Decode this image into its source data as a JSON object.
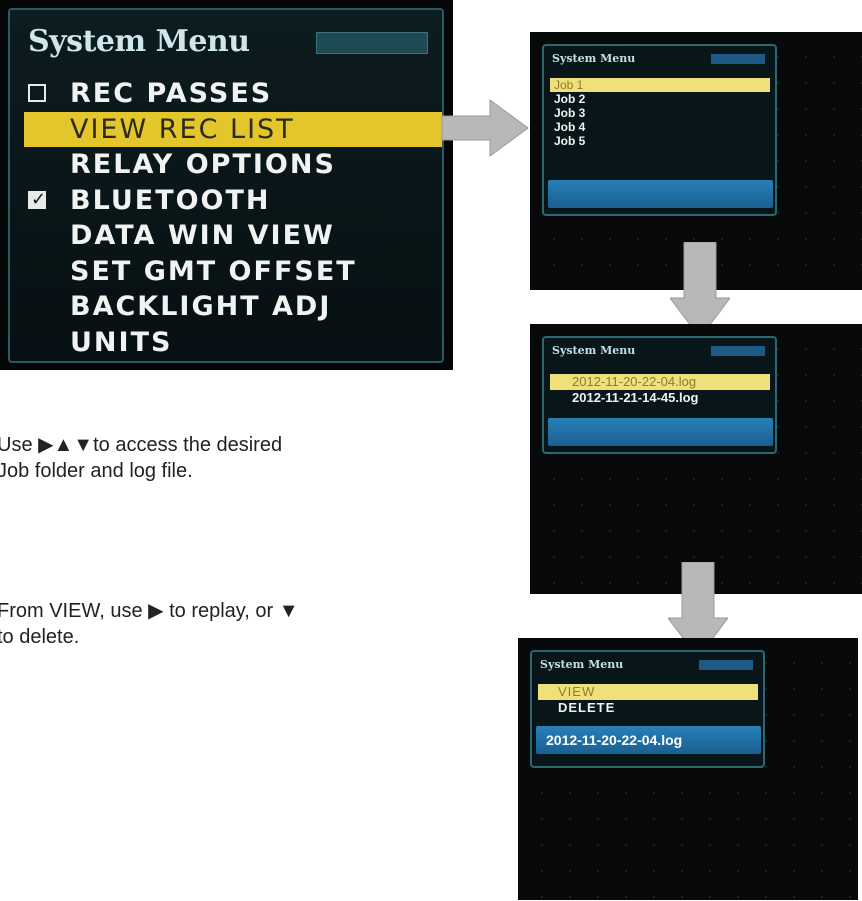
{
  "system_menu": {
    "title": "System Menu",
    "items": [
      {
        "label": "REC PASSES",
        "checkbox": "unchecked",
        "selected": false
      },
      {
        "label": "VIEW REC LIST",
        "checkbox": "none",
        "selected": true
      },
      {
        "label": "RELAY OPTIONS",
        "checkbox": "none",
        "selected": false
      },
      {
        "label": "BLUETOOTH",
        "checkbox": "checked",
        "selected": false
      },
      {
        "label": "DATA WIN VIEW",
        "checkbox": "none",
        "selected": false
      },
      {
        "label": "SET GMT OFFSET",
        "checkbox": "none",
        "selected": false
      },
      {
        "label": "BACKLIGHT ADJ",
        "checkbox": "none",
        "selected": false
      },
      {
        "label": "UNITS",
        "checkbox": "none",
        "selected": false
      }
    ]
  },
  "job_screen": {
    "title": "System Menu",
    "items": [
      "Job 1",
      "Job 2",
      "Job 3",
      "Job 4",
      "Job 5"
    ],
    "selected_index": 0
  },
  "log_screen": {
    "title": "System Menu",
    "items": [
      "2012-11-20-22-04.log",
      "2012-11-21-14-45.log"
    ],
    "selected_index": 0
  },
  "action_screen": {
    "title": "System Menu",
    "items": [
      "VIEW",
      "DELETE"
    ],
    "selected_index": 0,
    "file_label": "2012-11-20-22-04.log"
  },
  "instructions": {
    "nav": "Use ▶▲▼to access the desired\nJob folder and log file.",
    "view": "From VIEW, use ▶ to replay, or ▼\nto delete."
  },
  "colors": {
    "highlight": "#e3c52c",
    "screen_bg": "#07090a",
    "menu_border": "#2d6872",
    "blue_bar": "#2680b8",
    "arrow": "#b8b8b8"
  }
}
